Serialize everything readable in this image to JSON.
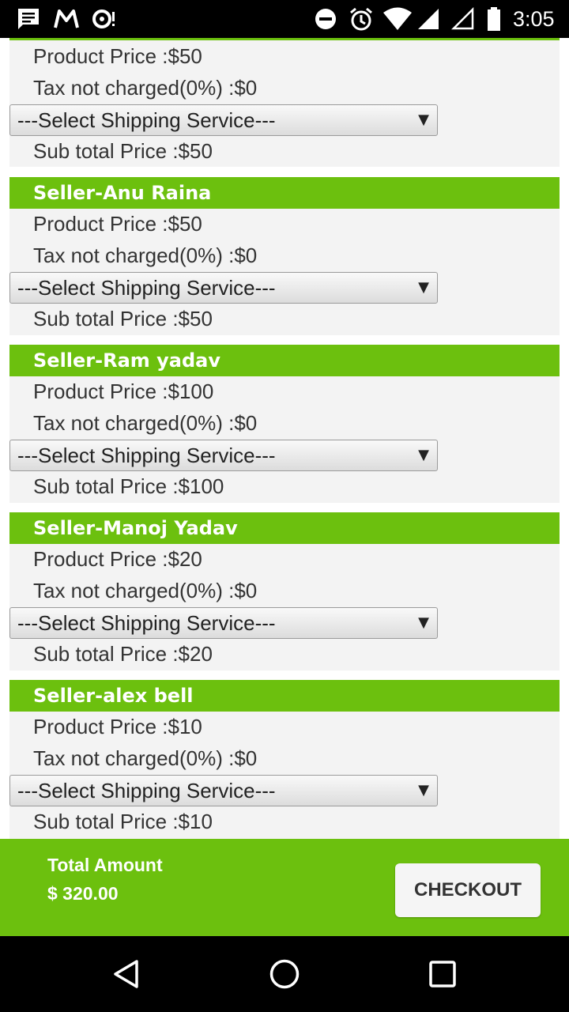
{
  "status_bar": {
    "time": "3:05",
    "icons": [
      "message-icon",
      "gmail-icon",
      "voicemail-icon",
      "do-not-disturb-icon",
      "alarm-icon",
      "wifi-icon",
      "signal-icon",
      "signal-empty-icon",
      "battery-icon"
    ]
  },
  "cards": [
    {
      "product_price": "Product Price :$50",
      "tax": "Tax not charged(0%) :$0",
      "shipping_select": "---Select Shipping Service---",
      "subtotal": "Sub total Price :$50"
    },
    {
      "seller": "Seller-Anu Raina",
      "product_price": "Product Price :$50",
      "tax": "Tax not charged(0%) :$0",
      "shipping_select": "---Select Shipping Service---",
      "subtotal": "Sub total Price :$50"
    },
    {
      "seller": "Seller-Ram yadav",
      "product_price": "Product Price :$100",
      "tax": "Tax not charged(0%) :$0",
      "shipping_select": "---Select Shipping Service---",
      "subtotal": "Sub total Price :$100"
    },
    {
      "seller": "Seller-Manoj Yadav",
      "product_price": "Product Price :$20",
      "tax": "Tax not charged(0%) :$0",
      "shipping_select": "---Select Shipping Service---",
      "subtotal": "Sub total Price :$20"
    },
    {
      "seller": "Seller-alex bell",
      "product_price": "Product Price :$10",
      "tax": "Tax not charged(0%) :$0",
      "shipping_select": "---Select Shipping Service---",
      "subtotal": "Sub total Price :$10"
    }
  ],
  "select_arrow": "▼",
  "footer": {
    "total_label": "Total Amount",
    "total_value": "$ 320.00",
    "checkout_label": "CHECKOUT"
  },
  "colors": {
    "accent_green": "#6cc00e",
    "card_bg": "#f3f3f3"
  },
  "nav_bar": {
    "icons": [
      "back-icon",
      "home-icon",
      "recents-icon"
    ]
  }
}
